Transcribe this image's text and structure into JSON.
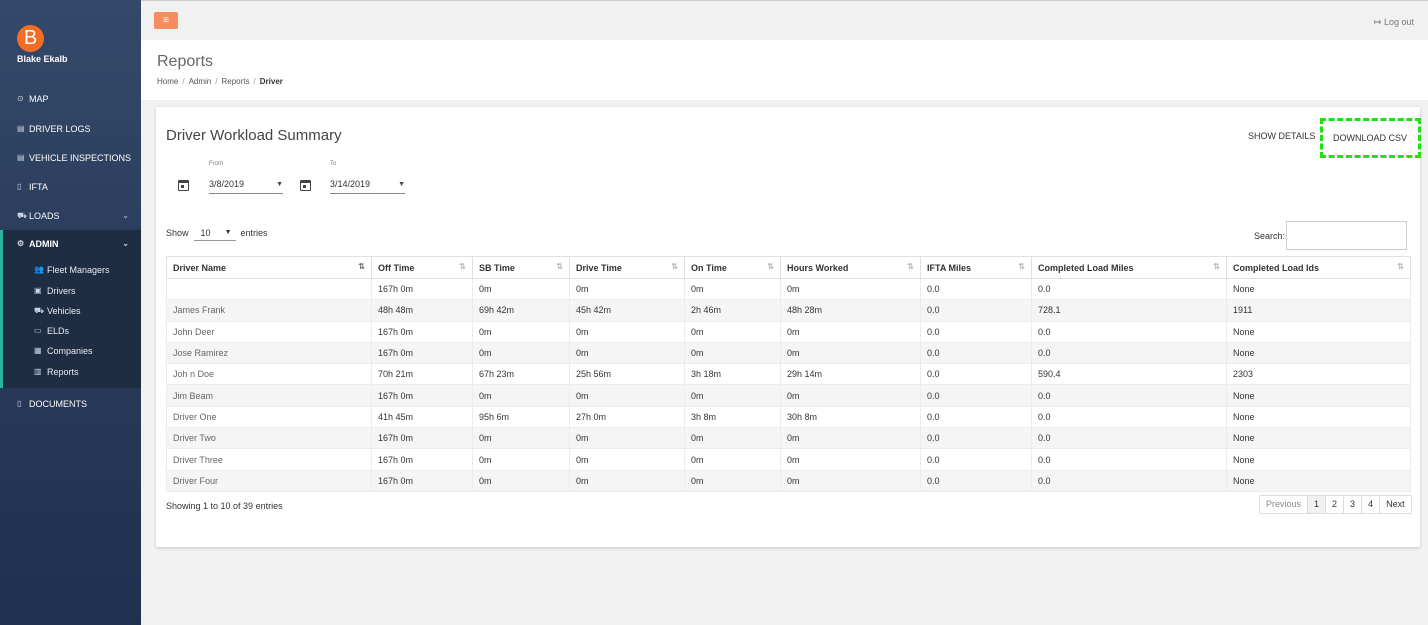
{
  "sidebar": {
    "avatar_letter": "B",
    "user_name": "Blake Ekalb",
    "items": [
      {
        "label": "MAP",
        "icon": "map-pin-icon"
      },
      {
        "label": "DRIVER LOGS",
        "icon": "clipboard-icon"
      },
      {
        "label": "VEHICLE INSPECTIONS",
        "icon": "clipboard-check-icon"
      },
      {
        "label": "IFTA",
        "icon": "document-icon"
      },
      {
        "label": "LOADS",
        "icon": "truck-icon"
      },
      {
        "label": "ADMIN",
        "icon": "gear-icon"
      },
      {
        "label": "DOCUMENTS",
        "icon": "document-icon"
      }
    ],
    "admin_items": [
      {
        "label": "Fleet Managers",
        "icon": "users-icon"
      },
      {
        "label": "Drivers",
        "icon": "id-card-icon"
      },
      {
        "label": "Vehicles",
        "icon": "truck-icon"
      },
      {
        "label": "ELDs",
        "icon": "laptop-icon"
      },
      {
        "label": "Companies",
        "icon": "building-icon"
      },
      {
        "label": "Reports",
        "icon": "bar-chart-icon"
      }
    ]
  },
  "topbar": {
    "menu_icon": "hamburger-icon",
    "logout_label": "Log out"
  },
  "header": {
    "title": "Reports",
    "breadcrumb": [
      "Home",
      "Admin",
      "Reports",
      "Driver"
    ]
  },
  "card": {
    "title": "Driver Workload Summary",
    "show_details": "SHOW DETAILS",
    "download_csv": "DOWNLOAD CSV",
    "from_label": "From",
    "from_value": "3/8/2019",
    "to_label": "To",
    "to_value": "3/14/2019",
    "show_label": "Show",
    "entries_value": "10",
    "entries_label": "entries",
    "search_label": "Search:",
    "showing_text": "Showing 1 to 10 of 39 entries",
    "pagination": [
      "Previous",
      "1",
      "2",
      "3",
      "4",
      "Next"
    ]
  },
  "table": {
    "columns": [
      "Driver Name",
      "Off Time",
      "SB Time",
      "Drive Time",
      "On Time",
      "Hours Worked",
      "IFTA Miles",
      "Completed Load Miles",
      "Completed Load Ids"
    ],
    "rows": [
      [
        "",
        "167h 0m",
        "0m",
        "0m",
        "0m",
        "0m",
        "0.0",
        "0.0",
        "None"
      ],
      [
        "James Frank",
        "48h 48m",
        "69h 42m",
        "45h 42m",
        "2h 46m",
        "48h 28m",
        "0.0",
        "728.1",
        "1911"
      ],
      [
        "John Deer",
        "167h 0m",
        "0m",
        "0m",
        "0m",
        "0m",
        "0.0",
        "0.0",
        "None"
      ],
      [
        "Jose Ramirez",
        "167h 0m",
        "0m",
        "0m",
        "0m",
        "0m",
        "0.0",
        "0.0",
        "None"
      ],
      [
        "Joh n Doe",
        "70h 21m",
        "67h 23m",
        "25h 56m",
        "3h 18m",
        "29h 14m",
        "0.0",
        "590.4",
        "2303"
      ],
      [
        "Jim Beam",
        "167h 0m",
        "0m",
        "0m",
        "0m",
        "0m",
        "0.0",
        "0.0",
        "None"
      ],
      [
        "Driver One",
        "41h 45m",
        "95h 6m",
        "27h 0m",
        "3h 8m",
        "30h 8m",
        "0.0",
        "0.0",
        "None"
      ],
      [
        "Driver Two",
        "167h 0m",
        "0m",
        "0m",
        "0m",
        "0m",
        "0.0",
        "0.0",
        "None"
      ],
      [
        "Driver Three",
        "167h 0m",
        "0m",
        "0m",
        "0m",
        "0m",
        "0.0",
        "0.0",
        "None"
      ],
      [
        "Driver Four",
        "167h 0m",
        "0m",
        "0m",
        "0m",
        "0m",
        "0.0",
        "0.0",
        "None"
      ]
    ]
  }
}
